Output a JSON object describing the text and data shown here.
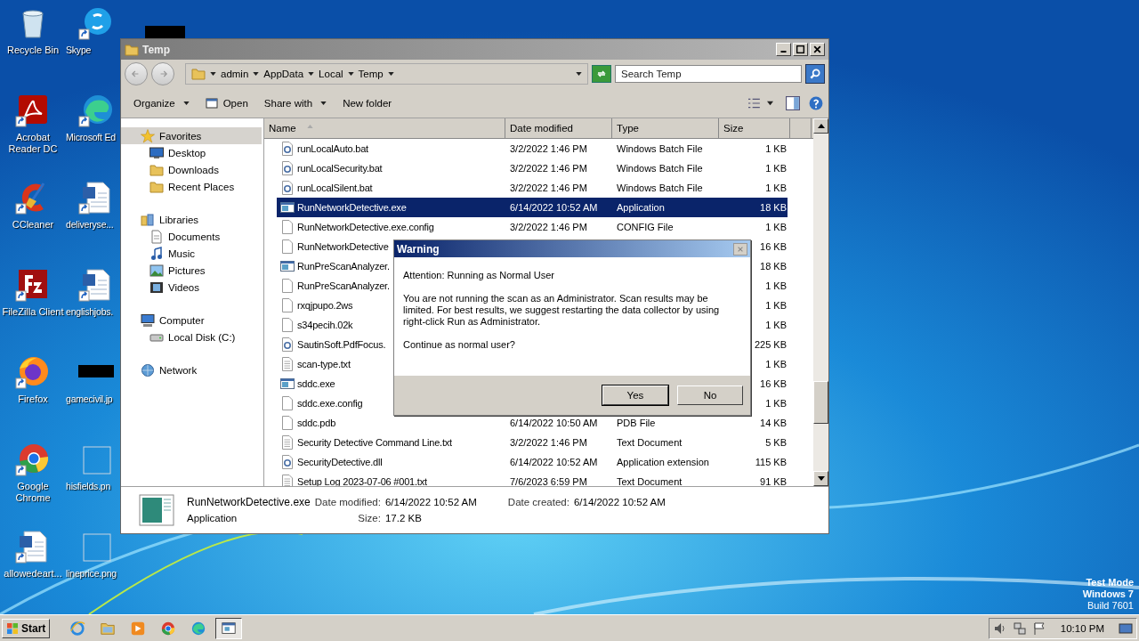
{
  "desktop": {
    "icons": [
      {
        "label": "Recycle Bin",
        "kind": "recycle"
      },
      {
        "label": "Skype",
        "kind": "chat"
      },
      {
        "label": "Acrobat Reader DC",
        "kind": "pdf"
      },
      {
        "label": "Microsoft Ed",
        "kind": "edge"
      },
      {
        "label": "CCleaner",
        "kind": "brush"
      },
      {
        "label": "deliveryse...",
        "kind": "word"
      },
      {
        "label": "FileZilla Client",
        "kind": "ftp"
      },
      {
        "label": "englishjobs.",
        "kind": "word"
      },
      {
        "label": "Firefox",
        "kind": "firefox"
      },
      {
        "label": "gamecivil.jp",
        "kind": "redacted"
      },
      {
        "label": "Google Chrome",
        "kind": "chrome"
      },
      {
        "label": "hisfields.pn",
        "kind": "image"
      },
      {
        "label": "allowedeart...",
        "kind": "word"
      },
      {
        "label": "lineprice.png",
        "kind": "image"
      }
    ],
    "os_info": [
      "Test Mode",
      "Windows 7",
      "Build 7601"
    ]
  },
  "window": {
    "title": "Temp",
    "breadcrumb": [
      "admin",
      "AppData",
      "Local",
      "Temp"
    ],
    "search": {
      "placeholder": "Search Temp"
    },
    "toolbar": [
      {
        "label": "Organize",
        "kind": "menu"
      },
      {
        "label": "Open",
        "kind": "open"
      },
      {
        "label": "Share with",
        "kind": "menu"
      },
      {
        "label": "New folder",
        "kind": "plain"
      }
    ],
    "sidebar": [
      {
        "label": "Favorites",
        "kind": "star",
        "selected": true,
        "children": [
          {
            "label": "Desktop",
            "kind": "monitor",
            "selected": false
          },
          {
            "label": "Downloads",
            "kind": "folder",
            "selected": false
          },
          {
            "label": "Recent Places",
            "kind": "folder",
            "selected": false
          }
        ]
      },
      {
        "label": "Libraries",
        "kind": "library",
        "selected": false,
        "children": [
          {
            "label": "Documents",
            "kind": "doc",
            "selected": false
          },
          {
            "label": "Music",
            "kind": "music",
            "selected": false
          },
          {
            "label": "Pictures",
            "kind": "picture",
            "selected": false
          },
          {
            "label": "Videos",
            "kind": "film",
            "selected": false
          }
        ]
      },
      {
        "label": "Computer",
        "kind": "computer",
        "selected": false,
        "children": [
          {
            "label": "Local Disk (C:)",
            "kind": "disk",
            "selected": false
          }
        ]
      },
      {
        "label": "Network",
        "kind": "network",
        "selected": false
      }
    ],
    "table": {
      "columns": [
        "Name",
        "Date modified",
        "Type",
        "Size"
      ],
      "rows": [
        {
          "name": "runLocalAuto.bat",
          "date": "3/2/2022 1:46 PM",
          "type": "Windows Batch File",
          "size": "1 KB",
          "kind": "gear",
          "selected": false
        },
        {
          "name": "runLocalSecurity.bat",
          "date": "3/2/2022 1:46 PM",
          "type": "Windows Batch File",
          "size": "1 KB",
          "kind": "gear",
          "selected": false
        },
        {
          "name": "runLocalSilent.bat",
          "date": "3/2/2022 1:46 PM",
          "type": "Windows Batch File",
          "size": "1 KB",
          "kind": "gear",
          "selected": false
        },
        {
          "name": "RunNetworkDetective.exe",
          "date": "6/14/2022 10:52 AM",
          "type": "Application",
          "size": "18 KB",
          "kind": "exe",
          "selected": true
        },
        {
          "name": "RunNetworkDetective.exe.config",
          "date": "3/2/2022 1:46 PM",
          "type": "CONFIG File",
          "size": "1 KB",
          "kind": "file",
          "selected": false
        },
        {
          "name": "RunNetworkDetective",
          "size": "16 KB",
          "kind": "file",
          "selected": false
        },
        {
          "name": "RunPreScanAnalyzer.",
          "size": "18 KB",
          "kind": "exe",
          "selected": false
        },
        {
          "name": "RunPreScanAnalyzer.",
          "size": "1 KB",
          "kind": "file",
          "selected": false
        },
        {
          "name": "rxqjpupo.2ws",
          "size": "1 KB",
          "kind": "file",
          "selected": false
        },
        {
          "name": "s34pecih.02k",
          "size": "1 KB",
          "kind": "file",
          "selected": false
        },
        {
          "name": "SautinSoft.PdfFocus.",
          "size": "225 KB",
          "kind": "gear",
          "selected": false
        },
        {
          "name": "scan-type.txt",
          "size": "1 KB",
          "kind": "text",
          "selected": false
        },
        {
          "name": "sddc.exe",
          "size": "16 KB",
          "kind": "exe",
          "selected": false
        },
        {
          "name": "sddc.exe.config",
          "size": "1 KB",
          "kind": "file",
          "selected": false
        },
        {
          "name": "sddc.pdb",
          "date": "6/14/2022 10:50 AM",
          "type": "PDB File",
          "size": "14 KB",
          "kind": "file",
          "selected": false
        },
        {
          "name": "Security Detective Command Line.txt",
          "date": "3/2/2022 1:46 PM",
          "type": "Text Document",
          "size": "5 KB",
          "kind": "text",
          "selected": false
        },
        {
          "name": "SecurityDetective.dll",
          "date": "6/14/2022 10:52 AM",
          "type": "Application extension",
          "size": "115 KB",
          "kind": "gear",
          "selected": false
        },
        {
          "name": "Setup Log 2023-07-06 #001.txt",
          "date": "7/6/2023 6:59 PM",
          "type": "Text Document",
          "size": "91 KB",
          "kind": "text",
          "selected": false
        }
      ]
    },
    "details": {
      "name": "RunNetworkDetective.exe",
      "type": "Application",
      "fields": [
        {
          "label": "Date modified:",
          "value": "6/14/2022 10:52 AM"
        },
        {
          "label": "Size:",
          "value": "17.2 KB"
        },
        {
          "label": "Date created:",
          "value": "6/14/2022 10:52 AM"
        }
      ]
    }
  },
  "dialog": {
    "title": "Warning",
    "paragraphs": [
      "Attention: Running as Normal User",
      "You are not running the scan as an Administrator. Scan results may be limited. For best results, we suggest restarting the data collector by using right-click Run as Administrator.",
      "Continue as normal user?"
    ],
    "buttons": [
      {
        "label": "Yes",
        "default": true
      },
      {
        "label": "No",
        "default": false
      }
    ]
  },
  "taskbar": {
    "start": "Start",
    "apps": [
      {
        "kind": "ie",
        "active": false
      },
      {
        "kind": "folder",
        "active": false
      },
      {
        "kind": "media",
        "active": false
      },
      {
        "kind": "chrome",
        "active": false
      },
      {
        "kind": "edge",
        "active": false
      },
      {
        "kind": "exe",
        "active": true
      }
    ],
    "clock": "10:10 PM"
  }
}
